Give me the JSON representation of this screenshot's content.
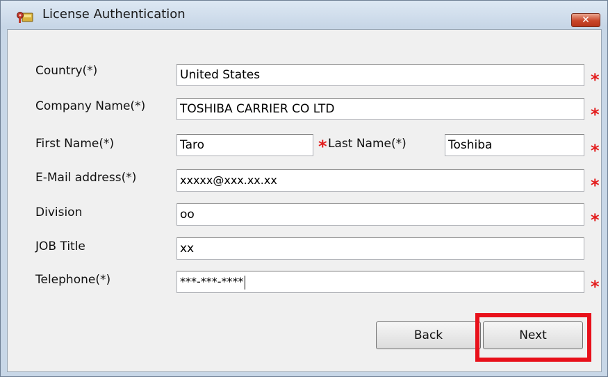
{
  "window": {
    "title": "License Authentication",
    "close_glyph": "✕",
    "icon": "key-lock-app-icon"
  },
  "form": {
    "country": {
      "label": "Country(*)",
      "value": "United States",
      "required": true
    },
    "company": {
      "label": "Company Name(*)",
      "value": "TOSHIBA CARRIER CO LTD",
      "required": true
    },
    "first_name": {
      "label": "First Name(*)",
      "value": "Taro",
      "required": true
    },
    "last_name": {
      "label": "Last Name(*)",
      "value": "Toshiba",
      "required": true
    },
    "email": {
      "label": "E-Mail address(*)",
      "value": "xxxxx@xxx.xx.xx",
      "required": true
    },
    "division": {
      "label": "Division",
      "value": "oo",
      "required": true
    },
    "job_title": {
      "label": "JOB Title",
      "value": "xx",
      "required": false
    },
    "telephone": {
      "label": "Telephone(*)",
      "value": "***-***-****",
      "required": true
    }
  },
  "required_marker": "*",
  "buttons": {
    "back": "Back",
    "next": "Next"
  },
  "colors": {
    "required_star": "#e31b1b",
    "highlight_box": "#e8101a",
    "close_button": "#c9462a"
  }
}
